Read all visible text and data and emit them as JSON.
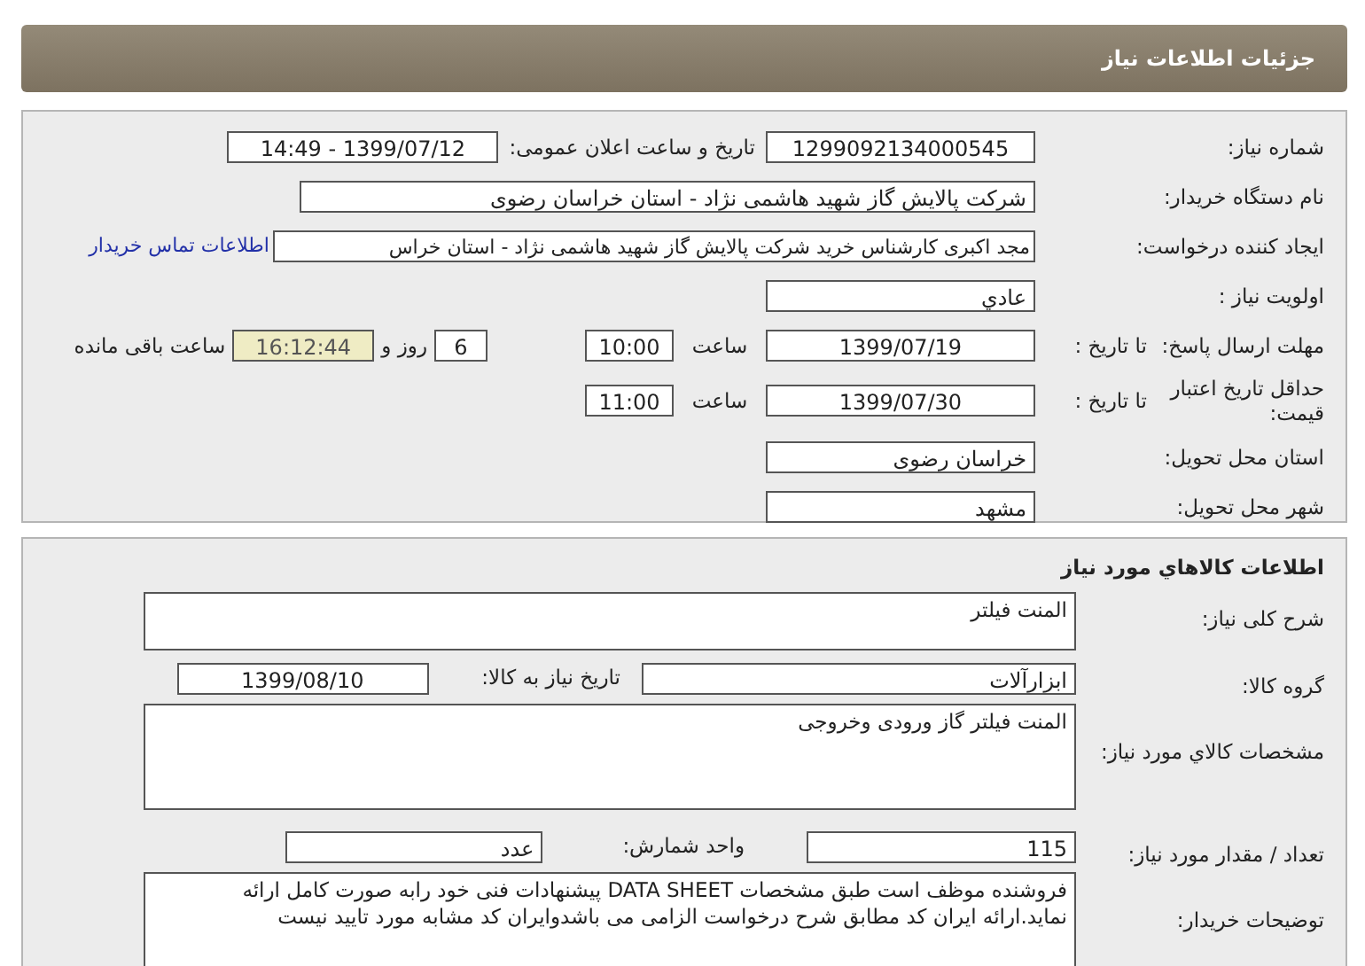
{
  "header": {
    "title": "جزئیات اطلاعات نیاز"
  },
  "need_info": {
    "need_number": {
      "label": "شماره نیاز:",
      "value": "1299092134000545"
    },
    "announce": {
      "label": "تاریخ و ساعت اعلان عمومی:",
      "value": "1399/07/12 - 14:49"
    },
    "buyer": {
      "label": "نام دستگاه خریدار:",
      "value": "شرکت پالایش گاز شهید هاشمی نژاد - استان خراسان رضوی"
    },
    "requester": {
      "label": "ایجاد کننده درخواست:",
      "value": "مجد اکبری کارشناس خرید شرکت پالایش گاز شهید هاشمی نژاد - استان خراس",
      "link": "اطلاعات تماس خریدار"
    },
    "priority": {
      "label": "اولویت نیاز :",
      "value": "عادي"
    },
    "response_deadline": {
      "label": "مهلت ارسال پاسخ:",
      "to_date_label": "تا تاریخ :",
      "date": "1399/07/19",
      "time_label": "ساعت",
      "time": "10:00",
      "days": "6",
      "days_label": "روز و",
      "remaining": "16:12:44",
      "remaining_label": "ساعت باقی مانده"
    },
    "price_validity": {
      "label": "حداقل تاریخ اعتبار قیمت:",
      "to_date_label": "تا تاریخ :",
      "date": "1399/07/30",
      "time_label": "ساعت",
      "time": "11:00"
    },
    "province": {
      "label": "استان محل تحویل:",
      "value": "خراسان رضوی"
    },
    "city": {
      "label": "شهر محل تحویل:",
      "value": "مشهد"
    }
  },
  "goods": {
    "title": "اطلاعات كالاهاي مورد نیاز",
    "summary": {
      "label": "شرح کلی نیاز:",
      "value": "المنت فیلتر"
    },
    "group": {
      "label": "گروه کالا:",
      "value": "ابزارآلات",
      "date_label": "تاریخ نیاز به کالا:",
      "date": "1399/08/10"
    },
    "specs": {
      "label": "مشخصات كالاي مورد نیاز:",
      "value": "المنت فیلتر گاز ورودی وخروجی"
    },
    "quantity": {
      "label": "تعداد / مقدار مورد نیاز:",
      "value": "115",
      "unit_label": "واحد شمارش:",
      "unit": "عدد"
    },
    "buyer_notes": {
      "label": "توضیحات خریدار:",
      "value": "فروشنده موظف است طبق مشخصات DATA SHEET  پیشنهادات فنی خود رابه صورت کامل ارائه نماید.ارائه ایران کد مطابق شرح درخواست  الزامی می باشدوایران کد مشابه مورد تایید نیست"
    }
  }
}
